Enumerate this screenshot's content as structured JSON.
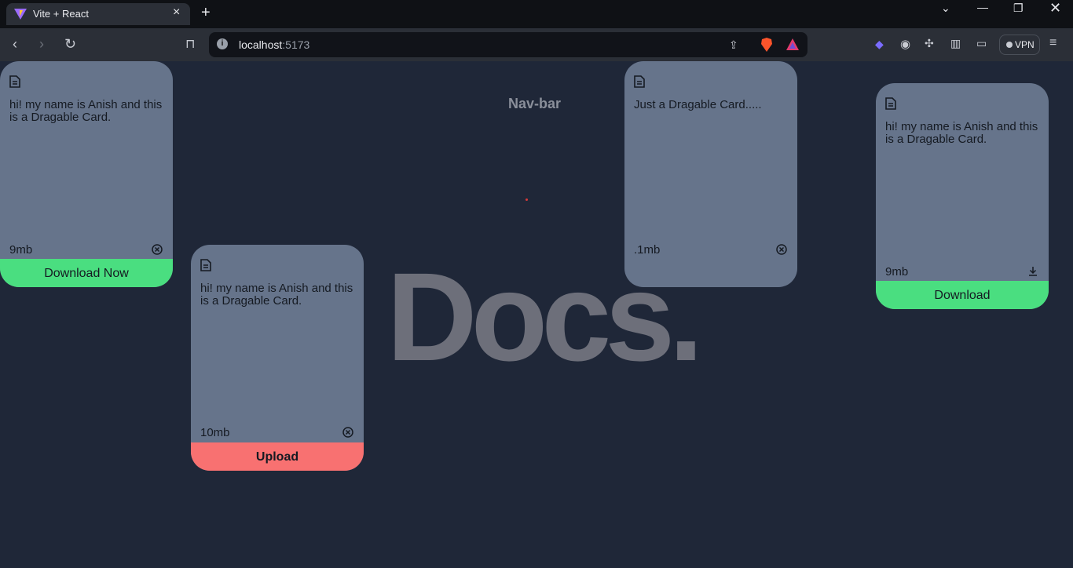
{
  "browser": {
    "tab_title": "Vite + React",
    "url_host": "localhost",
    "url_port": ":5173",
    "vpn_label": "VPN"
  },
  "page": {
    "nav_title": "Nav-bar",
    "logo_text": "Docs."
  },
  "cards": [
    {
      "text": "hi! my name is Anish and this is a Dragable Card.",
      "size": "9mb",
      "action_icon": "close-circle-icon",
      "button": "Download Now",
      "button_color": "#4ade80"
    },
    {
      "text": "hi! my name is Anish and this is a Dragable Card.",
      "size": "10mb",
      "action_icon": "close-circle-icon",
      "button": "Upload",
      "button_color": "#f87171"
    },
    {
      "text": "Just a Dragable Card.....",
      "size": ".1mb",
      "action_icon": "close-circle-icon",
      "button": ""
    },
    {
      "text": "hi! my name is Anish and this is a Dragable Card.",
      "size": "9mb",
      "action_icon": "download-icon",
      "button": "Download",
      "button_color": "#4ade80"
    }
  ]
}
